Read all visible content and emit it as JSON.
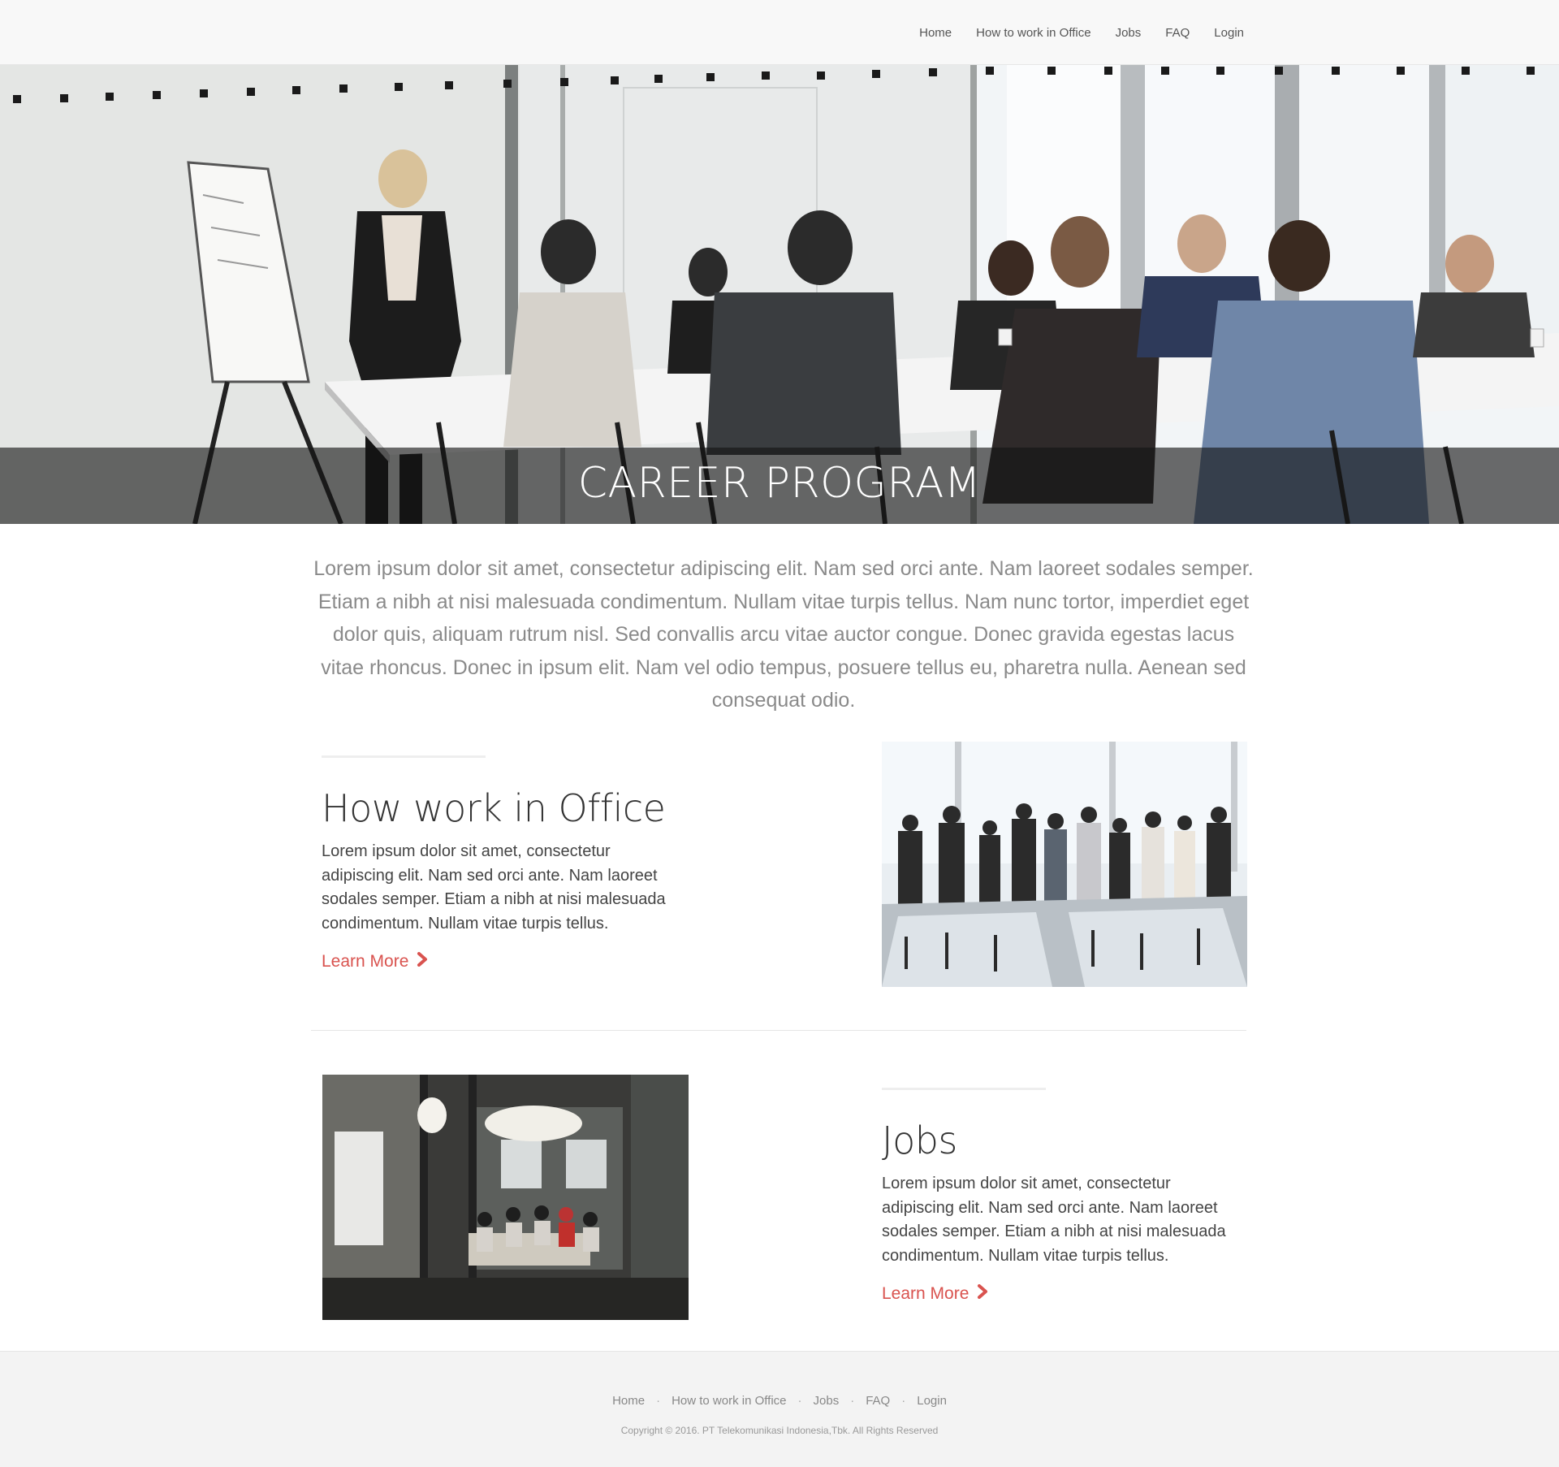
{
  "navbar": {
    "links": [
      "Home",
      "How to work in Office",
      "Jobs",
      "FAQ",
      "Login"
    ]
  },
  "hero": {
    "title": "CAREER PROGRAM"
  },
  "intro": {
    "text": "Lorem ipsum dolor sit amet, consectetur adipiscing elit. Nam sed orci ante. Nam laoreet sodales semper. Etiam a nibh at nisi malesuada condimentum. Nullam vitae turpis tellus. Nam nunc tortor, imperdiet eget dolor quis, aliquam rutrum nisl. Sed convallis arcu vitae auctor congue. Donec gravida egestas lacus vitae rhoncus. Donec in ipsum elit. Nam vel odio tempus, posuere tellus eu, pharetra nulla. Aenean sed consequat odio."
  },
  "features": [
    {
      "heading": "How work in Office",
      "text": "Lorem ipsum dolor sit amet, consectetur adipiscing elit. Nam sed orci ante. Nam laoreet sodales semper. Etiam a nibh at nisi malesuada condimentum. Nullam vitae turpis tellus.",
      "link": "Learn More"
    },
    {
      "heading": "Jobs",
      "text": "Lorem ipsum dolor sit amet, consectetur adipiscing elit. Nam sed orci ante. Nam laoreet sodales semper. Etiam a nibh at nisi malesuada condimentum. Nullam vitae turpis tellus.",
      "link": "Learn More"
    }
  ],
  "footer": {
    "links": [
      "Home",
      "How to work in Office",
      "Jobs",
      "FAQ",
      "Login"
    ],
    "separator": "·",
    "copyright": "Copyright © 2016. PT Telekomunikasi Indonesia,Tbk. All Rights Reserved"
  },
  "colors": {
    "accent": "#d9534f",
    "navbar_bg": "#f8f8f8",
    "footer_bg": "#f3f3f3",
    "hero_banner": "rgba(20,20,20,0.62)"
  },
  "icons": {
    "learn_more": "chevron-right-icon"
  }
}
